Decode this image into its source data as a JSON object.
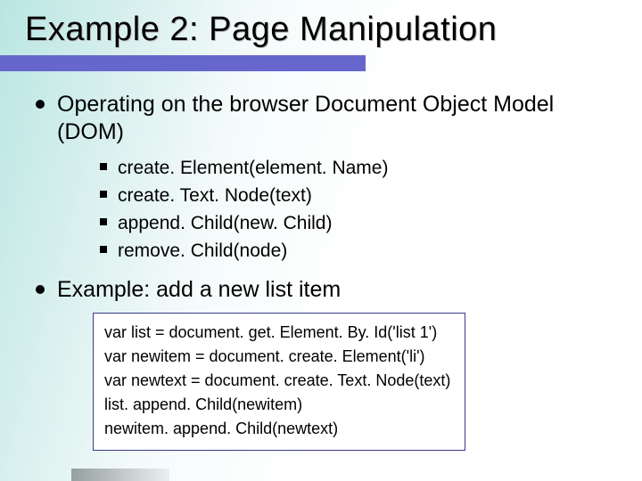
{
  "title": "Example 2: Page Manipulation",
  "bullets": {
    "b1a": "Operating on the browser Document Object Model (DOM)",
    "sub": {
      "s1": "create. Element(element. Name)",
      "s2": "create. Text. Node(text)",
      "s3": "append. Child(new. Child)",
      "s4": "remove. Child(node)"
    },
    "b1b": "Example: add a new list item"
  },
  "code": {
    "l1": "var list = document. get. Element. By. Id('list 1')",
    "l2": "var newitem = document. create. Element('li')",
    "l3": "var newtext = document. create. Text. Node(text)",
    "l4": "list. append. Child(newitem)",
    "l5": "newitem. append. Child(newtext)"
  }
}
